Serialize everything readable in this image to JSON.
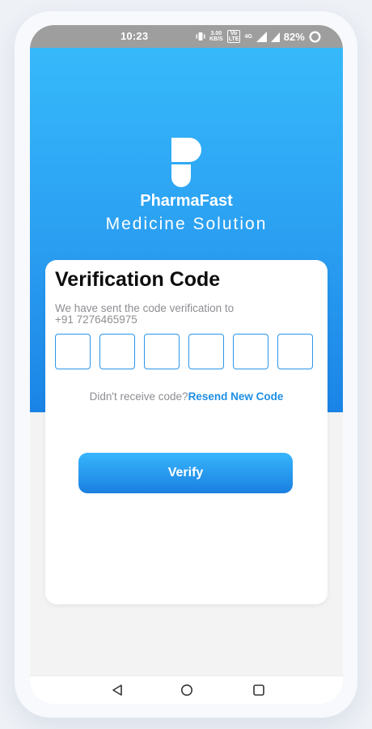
{
  "status_bar": {
    "time": "10:23",
    "speed": "3.00",
    "speed_unit": "KB/S",
    "volte_top": "Vo",
    "volte_bottom": "LTE",
    "network": "4G",
    "battery": "82%"
  },
  "brand": {
    "name": "PharmaFast",
    "tagline": "Medicine Solution",
    "logo_icon": "pharmafast-logo-icon"
  },
  "verification": {
    "title": "Verification Code",
    "subtitle": "We have sent the code verification to",
    "phone": "+91 7276465975",
    "otp_length": 6,
    "resend_prompt": "Didn't receive code?",
    "resend_link": "Resend New Code",
    "verify_label": "Verify"
  },
  "nav": {
    "icons": [
      "back-icon",
      "home-icon",
      "recents-icon"
    ]
  },
  "colors": {
    "accent": "#1f8fe5",
    "hero_top": "#36b9fb",
    "hero_bottom": "#1a84e6",
    "status_bar": "#9e9e9e"
  }
}
